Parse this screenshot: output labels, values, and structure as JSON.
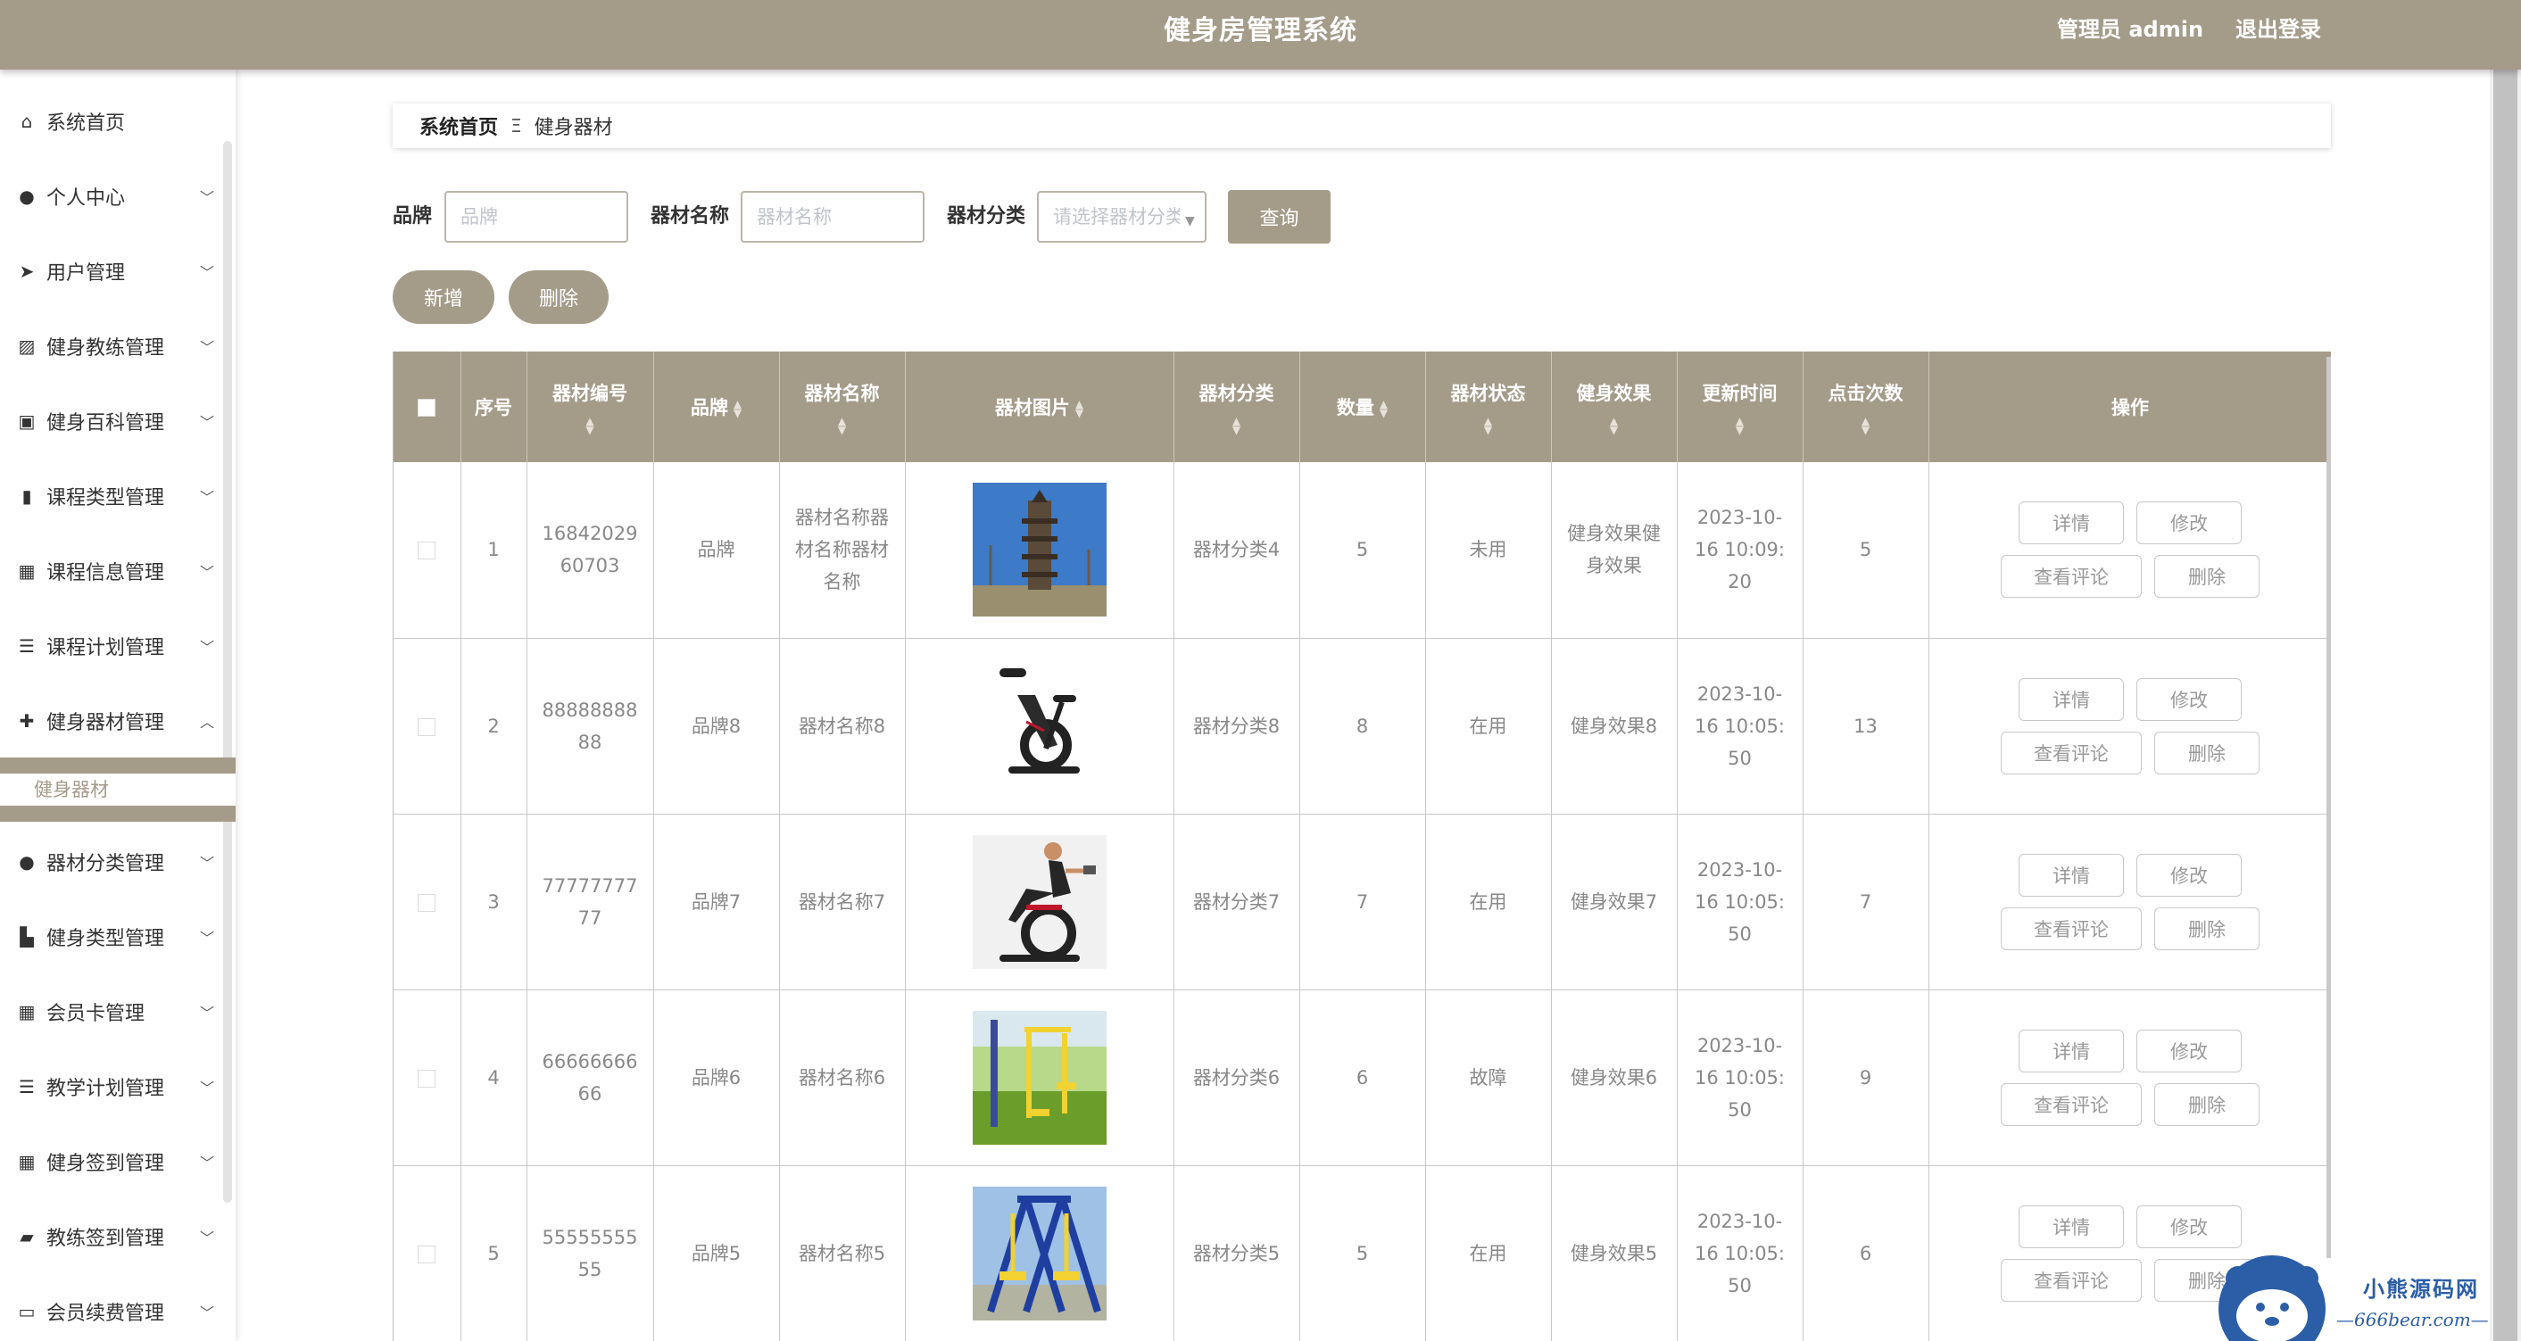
{
  "header": {
    "title": "健身房管理系统",
    "admin": "管理员 admin",
    "logout": "退出登录"
  },
  "sidebar": {
    "items": [
      {
        "label": "系统首页",
        "icon": "home-icon",
        "glyph": "⌂"
      },
      {
        "label": "个人中心",
        "icon": "user-icon",
        "glyph": "●"
      },
      {
        "label": "用户管理",
        "icon": "send-icon",
        "glyph": "➤"
      },
      {
        "label": "健身教练管理",
        "icon": "chart-icon",
        "glyph": "▨"
      },
      {
        "label": "健身百科管理",
        "icon": "clipboard-icon",
        "glyph": "▣"
      },
      {
        "label": "课程类型管理",
        "icon": "brush-icon",
        "glyph": "▮"
      },
      {
        "label": "课程信息管理",
        "icon": "grid-icon",
        "glyph": "▦"
      },
      {
        "label": "课程计划管理",
        "icon": "list-icon",
        "glyph": "☰"
      },
      {
        "label": "健身器材管理",
        "icon": "dumbbell-icon",
        "glyph": "✚"
      },
      {
        "label": "器材分类管理",
        "icon": "user-icon",
        "glyph": "●"
      },
      {
        "label": "健身类型管理",
        "icon": "book-icon",
        "glyph": "▙"
      },
      {
        "label": "会员卡管理",
        "icon": "grid-icon",
        "glyph": "▦"
      },
      {
        "label": "教学计划管理",
        "icon": "list-icon",
        "glyph": "☰"
      },
      {
        "label": "健身签到管理",
        "icon": "grid-icon",
        "glyph": "▦"
      },
      {
        "label": "教练签到管理",
        "icon": "wallet-icon",
        "glyph": "▰"
      },
      {
        "label": "会员续费管理",
        "icon": "monitor-icon",
        "glyph": "▭"
      }
    ],
    "submenu": {
      "label": "健身器材"
    }
  },
  "breadcrumb": {
    "home": "系统首页",
    "sep": "Ξ",
    "current": "健身器材"
  },
  "search": {
    "brand_label": "品牌",
    "brand_placeholder": "品牌",
    "name_label": "器材名称",
    "name_placeholder": "器材名称",
    "category_label": "器材分类",
    "category_placeholder": "请选择器材分类",
    "query_button": "查询"
  },
  "actions": {
    "add": "新增",
    "delete": "删除"
  },
  "table": {
    "columns": [
      "序号",
      "器材编号",
      "品牌",
      "器材名称",
      "器材图片",
      "器材分类",
      "数量",
      "器材状态",
      "健身效果",
      "更新时间",
      "点击次数",
      "操作"
    ],
    "rows": [
      {
        "index": "1",
        "code": "1684202960703",
        "brand": "品牌",
        "name": "器材名称器材名称器材名称",
        "category": "器材分类4",
        "qty": "5",
        "status": "未用",
        "effect": "健身效果健身效果",
        "time": "2023-10-16 10:09:20",
        "clicks": "5"
      },
      {
        "index": "2",
        "code": "8888888888",
        "brand": "品牌8",
        "name": "器材名称8",
        "category": "器材分类8",
        "qty": "8",
        "status": "在用",
        "effect": "健身效果8",
        "time": "2023-10-16 10:05:50",
        "clicks": "13"
      },
      {
        "index": "3",
        "code": "7777777777",
        "brand": "品牌7",
        "name": "器材名称7",
        "category": "器材分类7",
        "qty": "7",
        "status": "在用",
        "effect": "健身效果7",
        "time": "2023-10-16 10:05:50",
        "clicks": "7"
      },
      {
        "index": "4",
        "code": "6666666666",
        "brand": "品牌6",
        "name": "器材名称6",
        "category": "器材分类6",
        "qty": "6",
        "status": "故障",
        "effect": "健身效果6",
        "time": "2023-10-16 10:05:50",
        "clicks": "9"
      },
      {
        "index": "5",
        "code": "5555555555",
        "brand": "品牌5",
        "name": "器材名称5",
        "category": "器材分类5",
        "qty": "5",
        "status": "在用",
        "effect": "健身效果5",
        "time": "2023-10-16 10:05:50",
        "clicks": "6"
      }
    ],
    "ops": {
      "detail": "详情",
      "edit": "修改",
      "comments": "查看评论",
      "delete": "删除"
    }
  },
  "watermark": {
    "line1": "小熊源码网",
    "line2": "—666bear.com—"
  },
  "colors": {
    "accent": "#a59b89"
  }
}
